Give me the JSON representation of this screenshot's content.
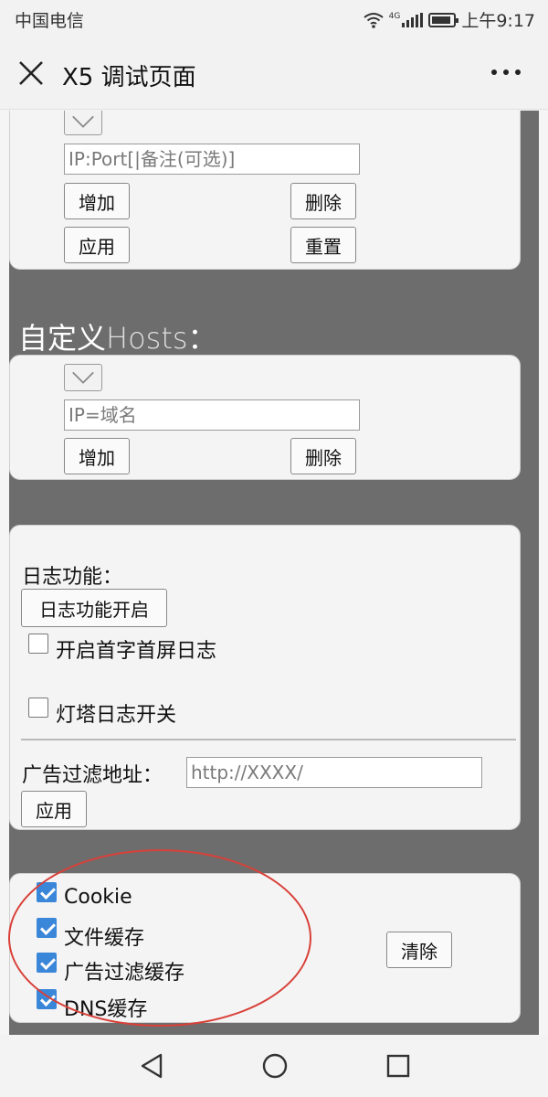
{
  "status_bar": {
    "carrier": "中国电信",
    "network": "4G",
    "time": "上午9:17"
  },
  "nav": {
    "title": "X5 调试页面"
  },
  "proxy_card": {
    "input_placeholder": "IP:Port[|备注(可选)]",
    "add_label": "增加",
    "delete_label": "删除",
    "apply_label": "应用",
    "reset_label": "重置"
  },
  "hosts": {
    "heading_cn": "自定义",
    "heading_en": "Hosts",
    "heading_colon": "：",
    "input_placeholder": "IP=域名",
    "add_label": "增加",
    "delete_label": "删除"
  },
  "log": {
    "title": "日志功能：",
    "toggle_label": "日志功能开启",
    "first_screen_label": "开启首字首屏日志",
    "first_screen_checked": false,
    "lighthouse_label": "灯塔日志开关",
    "lighthouse_checked": false,
    "ad_filter_label": "广告过滤地址：",
    "ad_filter_placeholder": "http://XXXX/",
    "apply_label": "应用"
  },
  "cache": {
    "items": [
      {
        "label": "Cookie",
        "checked": true
      },
      {
        "label": "文件缓存",
        "checked": true
      },
      {
        "label": "广告过滤缓存",
        "checked": true
      },
      {
        "label": "DNS缓存",
        "checked": true
      }
    ],
    "clear_label": "清除"
  },
  "colors": {
    "background_gray": "#6d6d6d",
    "checkbox_blue": "#3a86d8",
    "annotation_red": "#d84038"
  }
}
